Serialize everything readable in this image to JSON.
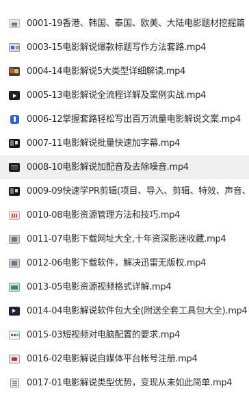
{
  "files": [
    {
      "name": "0001-19香港、韩国、泰国、欧美、大陆电影题材挖掘篇",
      "icon": "document-thumbnail-icon",
      "style": "t-light",
      "selected": false
    },
    {
      "name": "0003-15电影解说爆款标题写作方法套路.mp4",
      "icon": "video-thumbnail-icon",
      "style": "t-news",
      "selected": false
    },
    {
      "name": "0004-14电影解说5大类型详细解读.mp4",
      "icon": "video-thumbnail-icon",
      "style": "t-color",
      "selected": false
    },
    {
      "name": "0005-13电影解说全流程详解及案例实战.mp4",
      "icon": "video-thumbnail-icon",
      "style": "t-dark",
      "selected": false
    },
    {
      "name": "0006-12掌握套路轻松写出百万流量电影解说文案.mp4",
      "icon": "video-thumbnail-icon",
      "style": "t-blue",
      "selected": false
    },
    {
      "name": "0007-11电影解说批量快速加字幕.mp4",
      "icon": "video-thumbnail-icon",
      "style": "t-black",
      "selected": false
    },
    {
      "name": "0008-10电影解说加配音及去除噪音.mp4",
      "icon": "video-thumbnail-icon",
      "style": "t-film",
      "selected": true
    },
    {
      "name": "0009-09快速学PR剪辑(项目、导入、剪辑、特效、声音、",
      "icon": "video-thumbnail-icon",
      "style": "t-black",
      "selected": false
    },
    {
      "name": "0010-08电影资源管理方法和技巧.mp4",
      "icon": "video-thumbnail-icon",
      "style": "t-pink",
      "selected": false
    },
    {
      "name": "0011-07电影下载网址大全,十年资深影迷收藏.mp4",
      "icon": "video-thumbnail-icon",
      "style": "t-gray",
      "selected": false
    },
    {
      "name": "0012-06电影下载软件，解决迅雷无版权.mp4",
      "icon": "video-thumbnail-icon",
      "style": "t-gray",
      "selected": false
    },
    {
      "name": "0013-05电影资源视频格式详解.mp4",
      "icon": "video-thumbnail-icon",
      "style": "t-teal",
      "selected": false
    },
    {
      "name": "0014-04电影解说软件包大全(附送全套工具包大全).mp4",
      "icon": "video-thumbnail-icon",
      "style": "t-dark2",
      "selected": false
    },
    {
      "name": "0015-03短视频对电脑配置的要求.mp4",
      "icon": "video-thumbnail-icon",
      "style": "t-dots",
      "selected": false
    },
    {
      "name": "0016-02电影解说自媒体平台帐号注册.mp4",
      "icon": "video-thumbnail-icon",
      "style": "t-stamp",
      "selected": false
    },
    {
      "name": "0017-01电影解说类型优势，变现从未如此简单.mp4",
      "icon": "video-thumbnail-icon",
      "style": "t-doc",
      "selected": false
    }
  ],
  "colors": {
    "text": "#2b2b2b",
    "selected_row": "#f0f0f0",
    "background": "#ffffff"
  }
}
